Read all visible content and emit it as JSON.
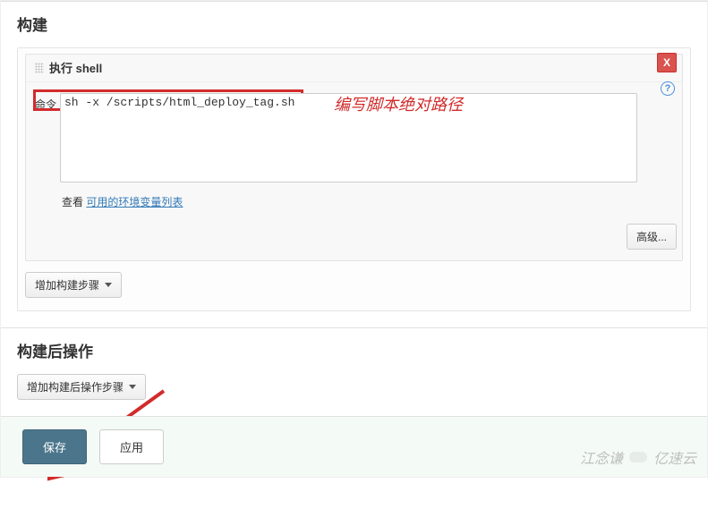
{
  "build": {
    "title": "构建",
    "step": {
      "header": "执行 shell",
      "close_label": "X",
      "command_label": "命令",
      "command_value": "sh -x /scripts/html_deploy_tag.sh",
      "annotation": "编写脚本绝对路径",
      "see_prefix": "查看 ",
      "see_link": "可用的环境变量列表",
      "advanced_label": "高级..."
    },
    "add_step_label": "增加构建步骤"
  },
  "post_build": {
    "title": "构建后操作",
    "add_step_label": "增加构建后操作步骤"
  },
  "footer": {
    "save_label": "保存",
    "apply_label": "应用"
  },
  "watermark": "江念谦",
  "watermark2": "亿速云"
}
